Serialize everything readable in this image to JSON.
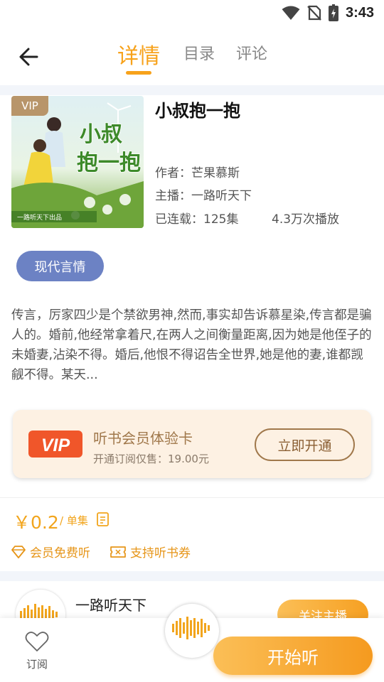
{
  "status_bar": {
    "time": "3:43"
  },
  "header": {
    "tabs": [
      {
        "label": "详情",
        "active": true
      },
      {
        "label": "目录",
        "active": false
      },
      {
        "label": "评论",
        "active": false
      }
    ]
  },
  "book": {
    "vip_tag": "VIP",
    "title": "小叔抱一抱",
    "cover_title": "小叔抱一抱",
    "cover_footer": "一路听天下出品",
    "author": "作者：芒果慕斯",
    "narrator": "主播：一路听天下",
    "episodes": "已连载：125集",
    "plays": "4.3万次播放",
    "genre": "现代言情",
    "description": "传言，厉家四少是个禁欲男神,然而,事实却告诉慕星染,传言都是骗人的。婚前,他经常拿着尺,在两人之间衡量距离,因为她是他侄子的未婚妻,沾染不得。婚后,他恨不得诏告全世界,她是他的妻,谁都觊觎不得。某天..."
  },
  "vip_card": {
    "logo_text": "VIP",
    "title": "听书会员体验卡",
    "subtitle": "开通订阅仅售：19.00元",
    "button": "立即开通"
  },
  "price": {
    "amount": "￥0.2",
    "unit": "/ 单集",
    "perks": [
      "会员免费听",
      "支持听书券"
    ]
  },
  "narrator_section": {
    "name": "一路听天下",
    "follow_button": "关注主播"
  },
  "bottom_bar": {
    "subscribe_label": "订阅",
    "start_button": "开始听"
  },
  "colors": {
    "accent": "#f7a21b",
    "genre_tag": "#6c82c4",
    "vip_red": "#f0562a",
    "vip_card_bg": "#fdf1e3"
  }
}
